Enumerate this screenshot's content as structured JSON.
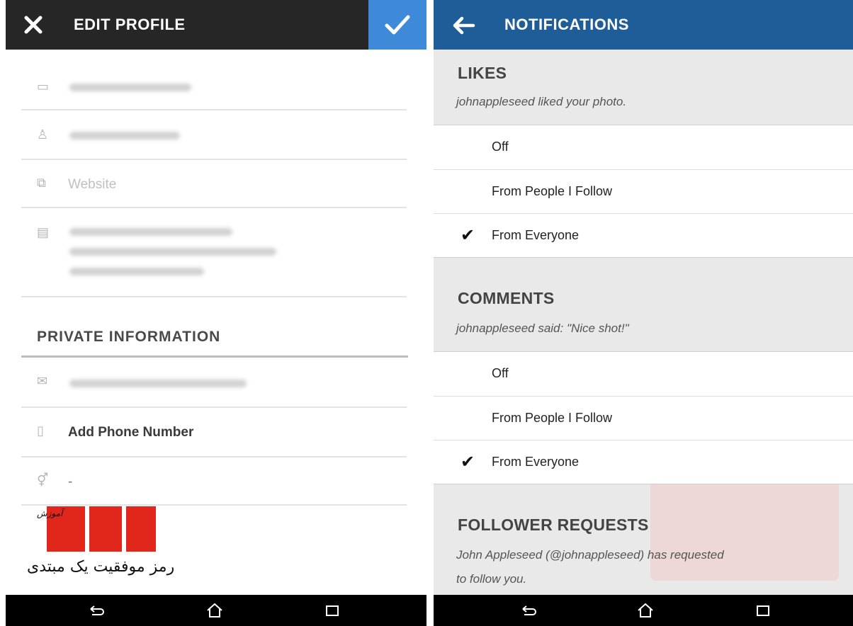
{
  "left": {
    "title": "EDIT PROFILE",
    "website_placeholder": "Website",
    "private_heading": "PRIVATE INFORMATION",
    "phone_label": "Add Phone Number",
    "gender_value": "-",
    "watermark_text": "رمز موفقیت یک مبتدی",
    "watermark_small": "آموزش"
  },
  "right": {
    "title": "NOTIFICATIONS",
    "sections": [
      {
        "heading": "LIKES",
        "description": "johnappleseed liked your photo.",
        "options": [
          {
            "label": "Off",
            "selected": false
          },
          {
            "label": "From People I Follow",
            "selected": false
          },
          {
            "label": "From Everyone",
            "selected": true
          }
        ]
      },
      {
        "heading": "COMMENTS",
        "description": "johnappleseed said: \"Nice shot!\"",
        "options": [
          {
            "label": "Off",
            "selected": false
          },
          {
            "label": "From People I Follow",
            "selected": false
          },
          {
            "label": "From Everyone",
            "selected": true
          }
        ]
      },
      {
        "heading": "FOLLOWER REQUESTS",
        "description_line1": "John Appleseed (@johnappleseed) has requested",
        "description_line2": "to follow you."
      }
    ],
    "check_glyph": "✔"
  },
  "colors": {
    "dark_bar": "#262626",
    "blue_bar": "#1f5d98",
    "accent_blue": "#3f8ad8",
    "watermark_red": "#e1261c"
  }
}
